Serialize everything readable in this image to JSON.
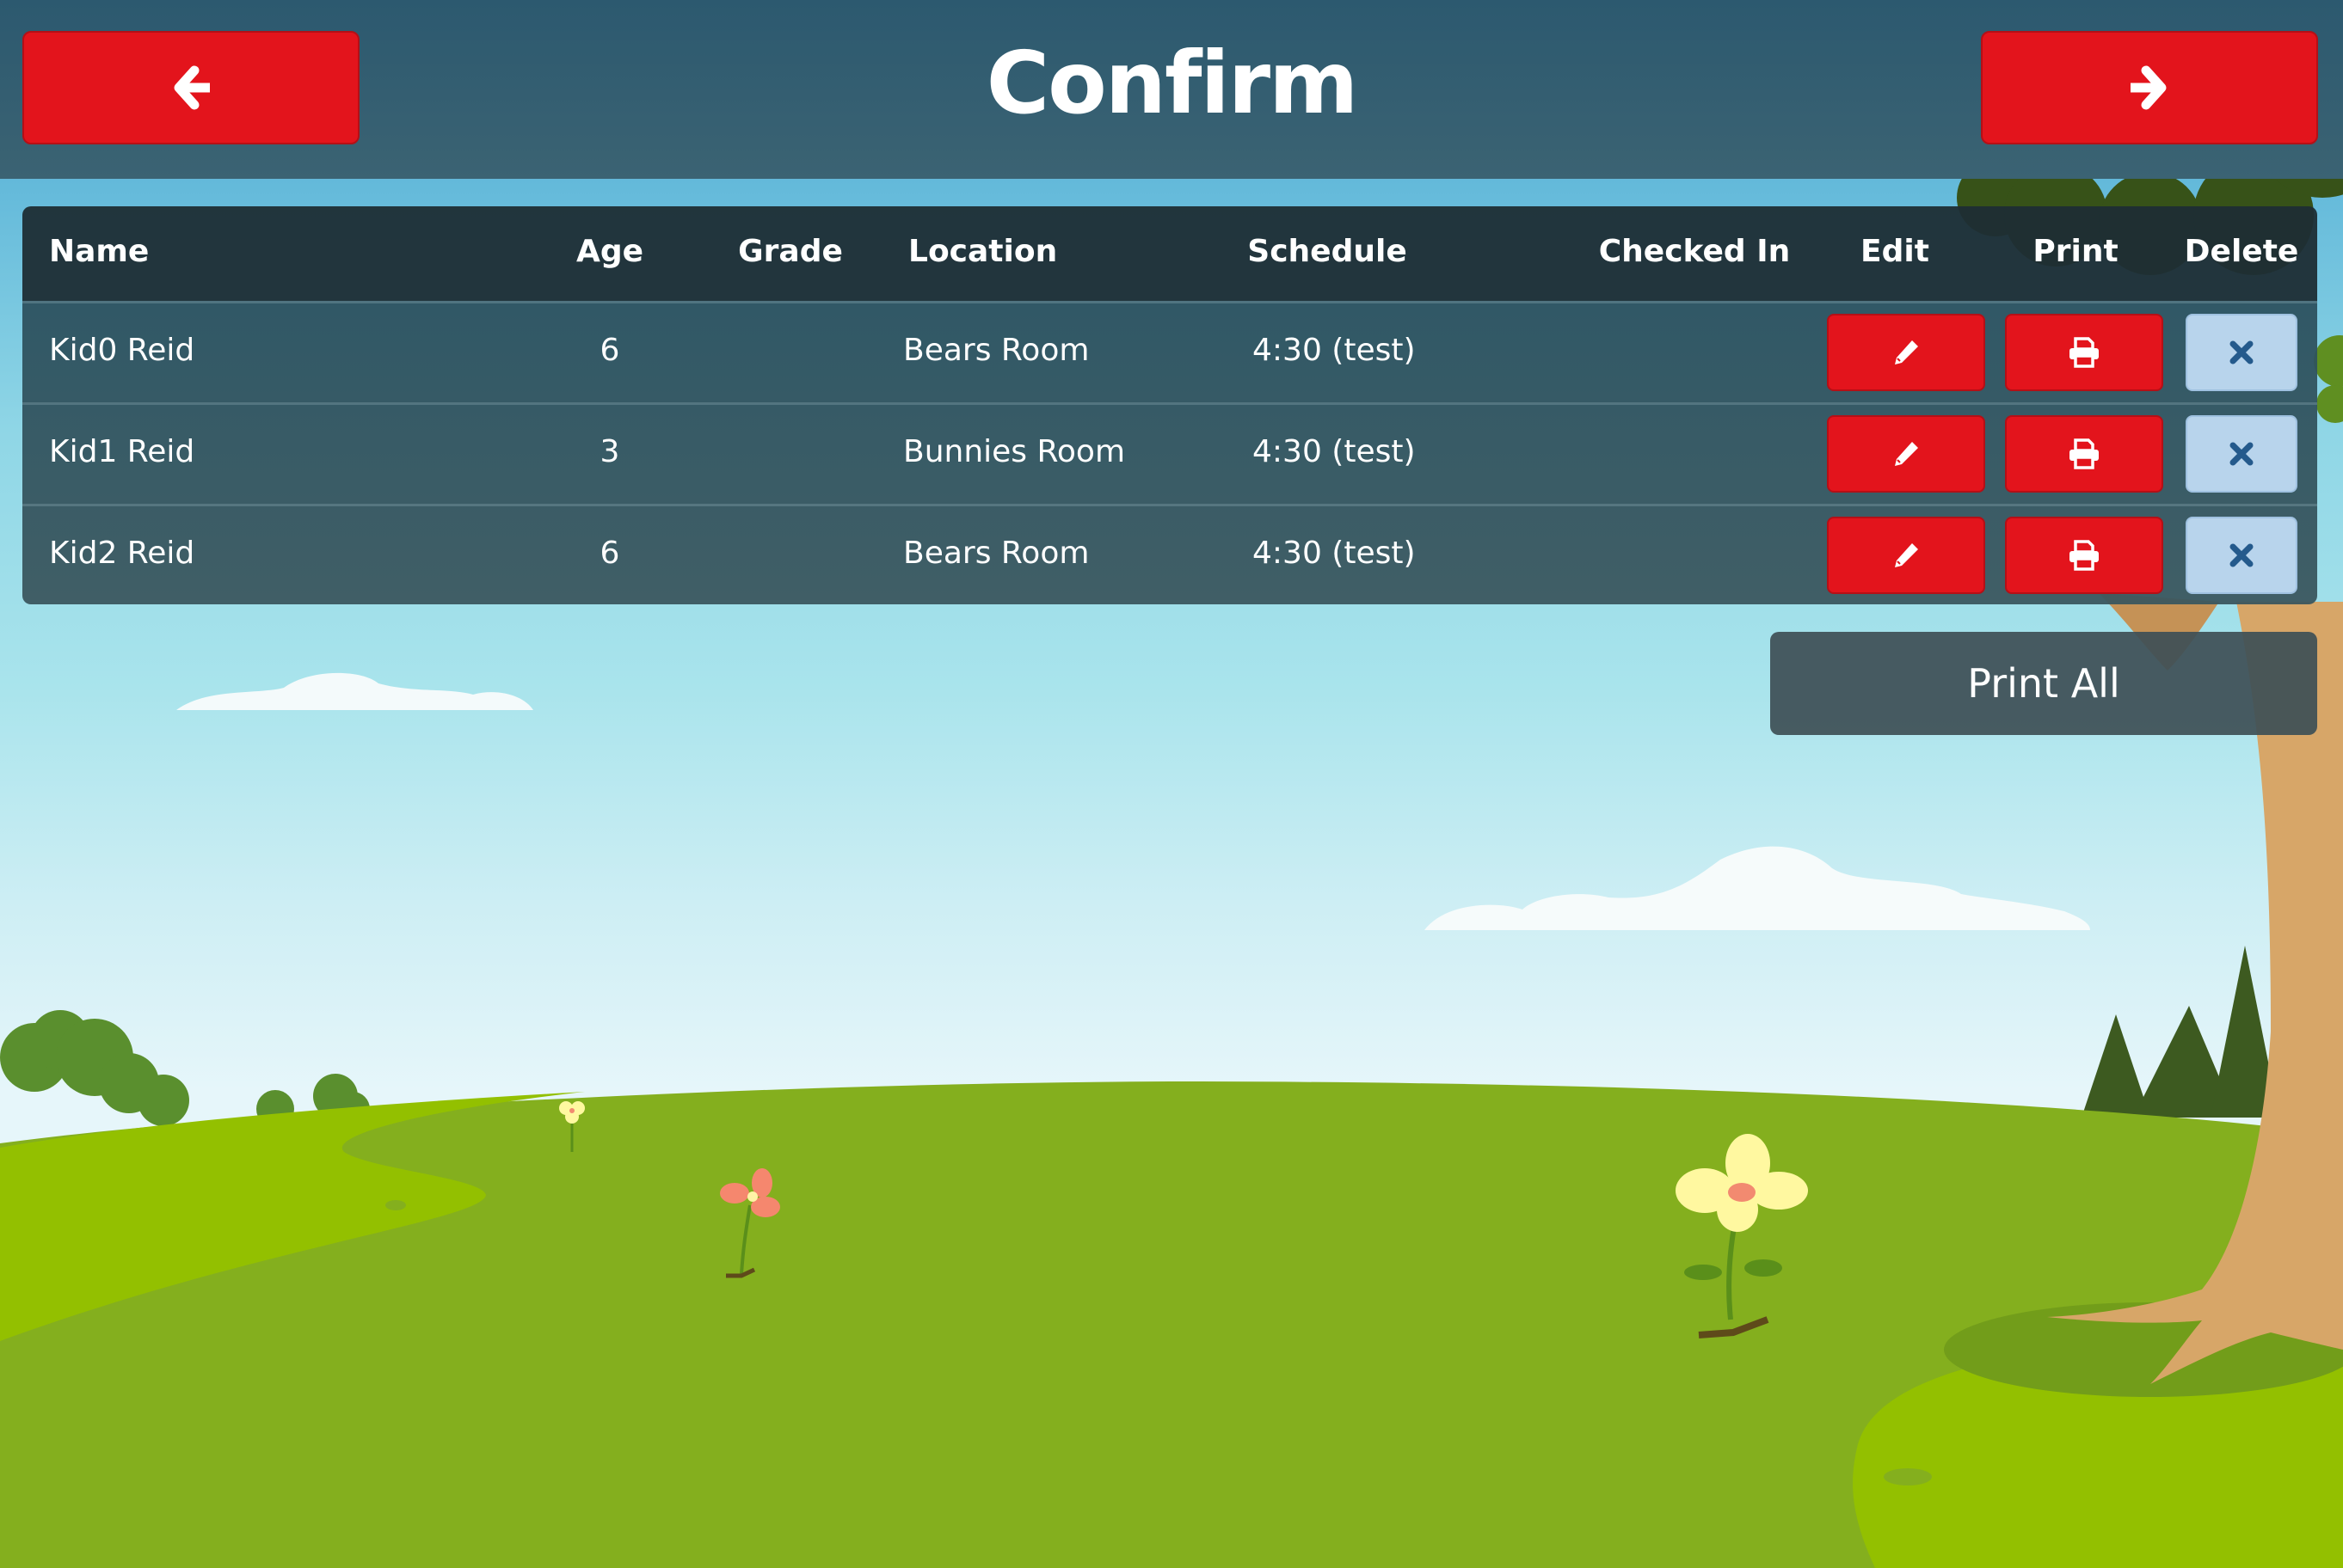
{
  "header": {
    "title": "Confirm",
    "back_icon": "arrow-left-icon",
    "next_icon": "arrow-right-icon"
  },
  "table": {
    "columns": [
      "Name",
      "Age",
      "Grade",
      "Location",
      "Schedule",
      "Checked In",
      "Edit",
      "Print",
      "Delete"
    ],
    "rows": [
      {
        "name": "Kid0 Reid",
        "age": "6",
        "grade": "",
        "location": "Bears Room",
        "schedule": "4:30 (test)",
        "checked_in": ""
      },
      {
        "name": "Kid1 Reid",
        "age": "3",
        "grade": "",
        "location": "Bunnies Room",
        "schedule": "4:30 (test)",
        "checked_in": ""
      },
      {
        "name": "Kid2 Reid",
        "age": "6",
        "grade": "",
        "location": "Bears Room",
        "schedule": "4:30 (test)",
        "checked_in": ""
      }
    ],
    "row_actions": {
      "edit_icon": "pencil-icon",
      "print_icon": "printer-icon",
      "delete_icon": "close-icon"
    }
  },
  "print_all_label": "Print All",
  "colors": {
    "primary_button": "#e3141c",
    "delete_button": "#b8d4ec",
    "delete_icon": "#245a8c",
    "header_bg": "#2c596f"
  }
}
